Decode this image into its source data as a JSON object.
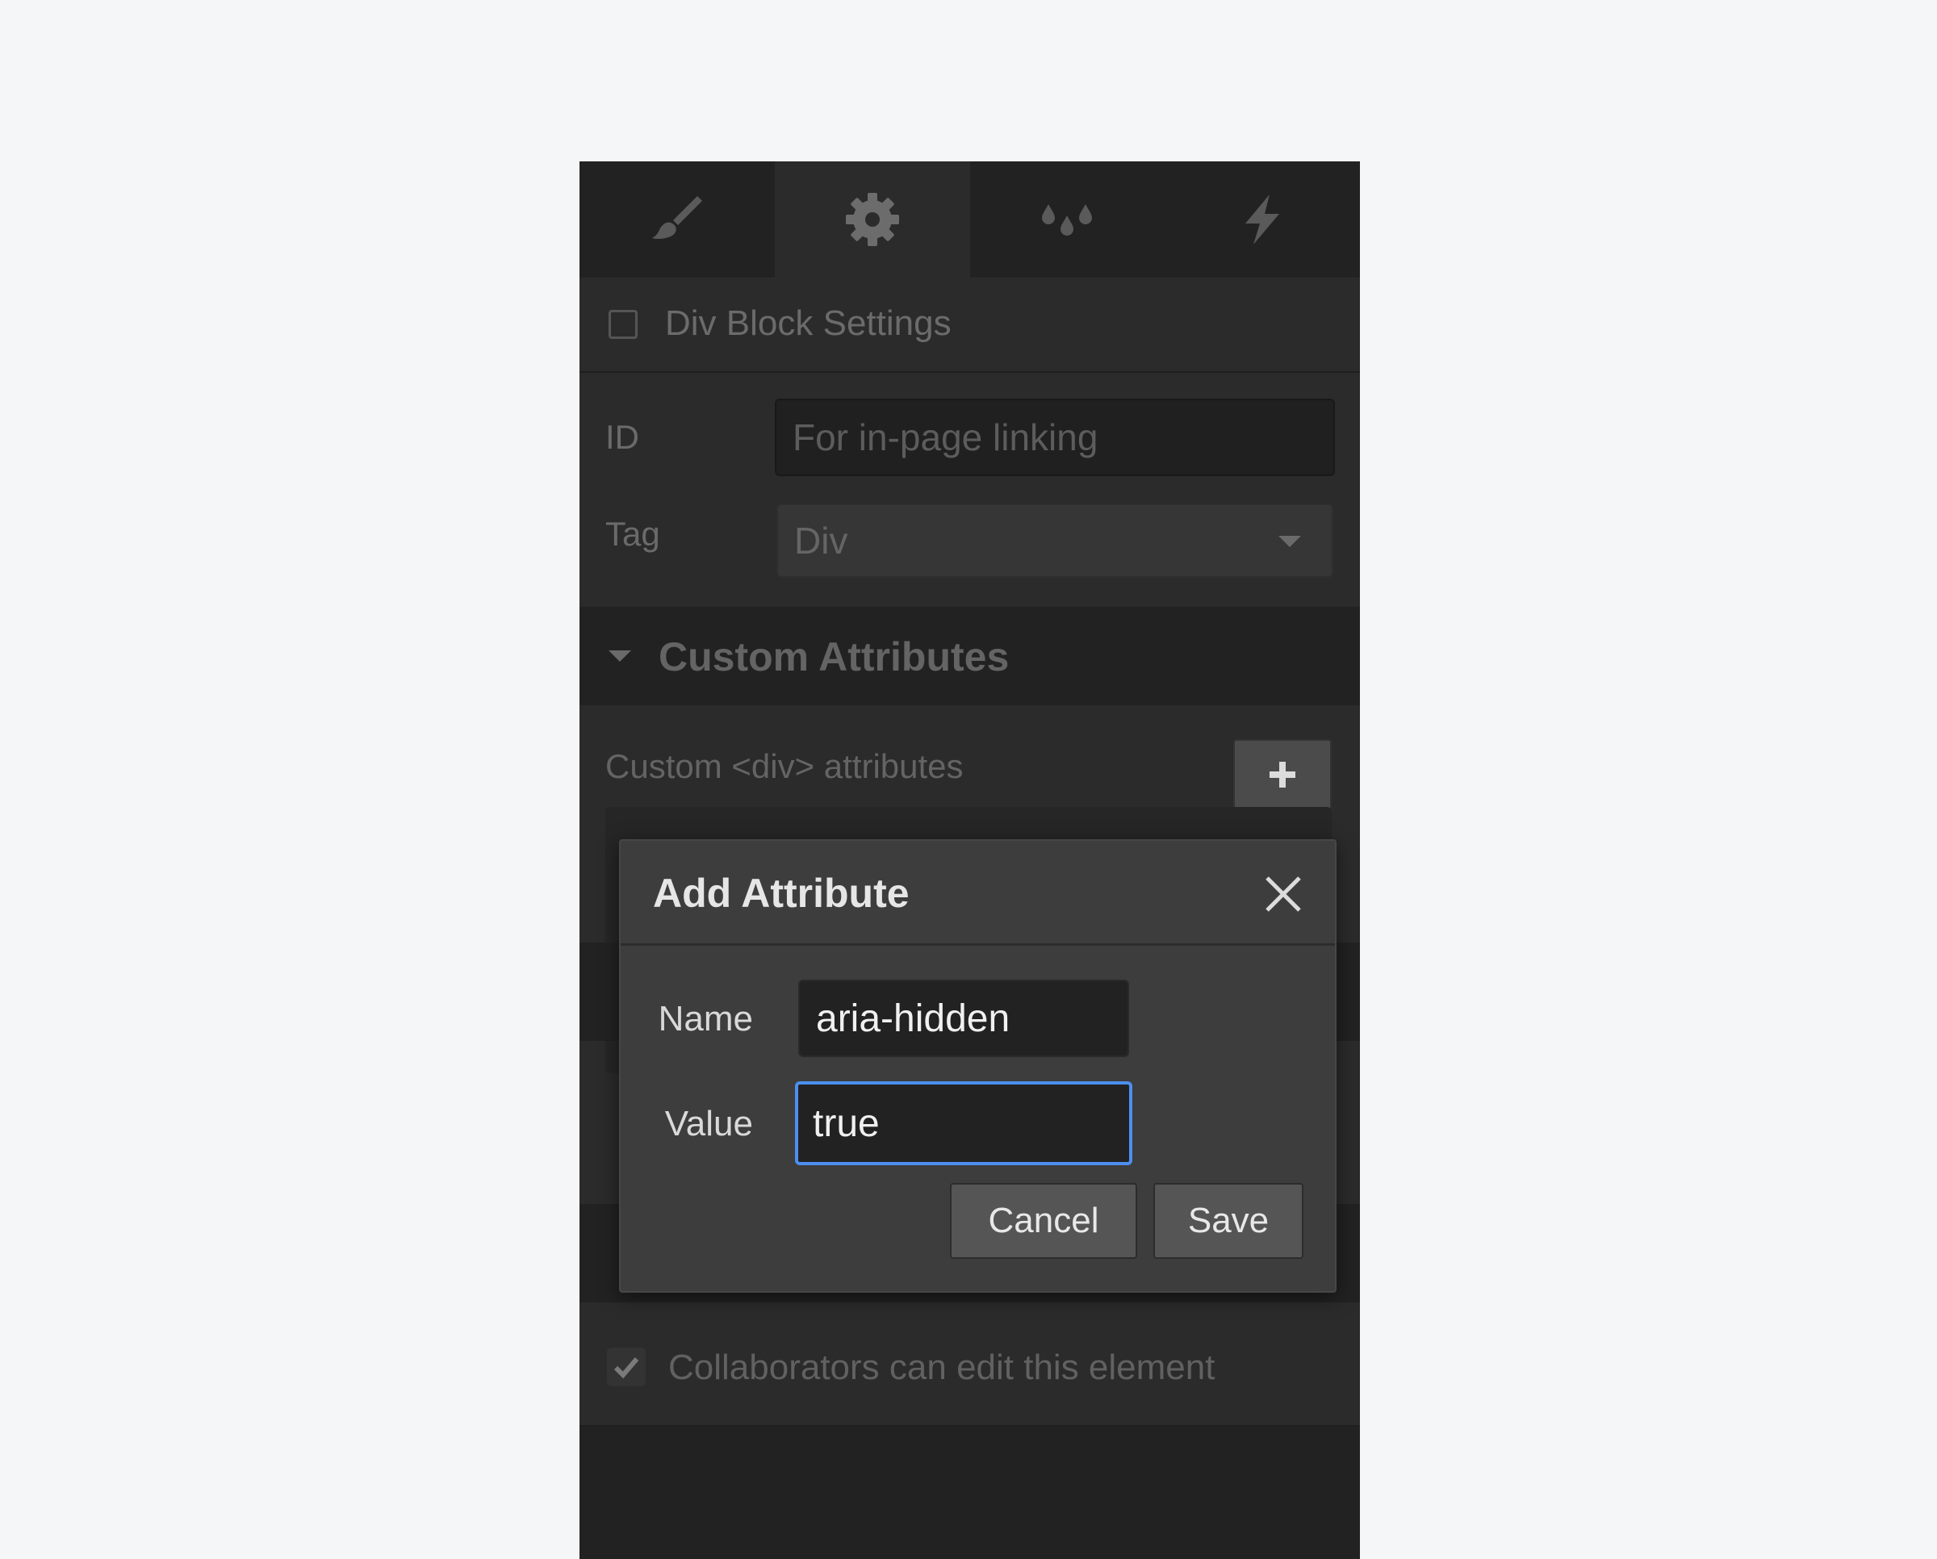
{
  "tabs": [
    {
      "name": "style",
      "icon": "paintbrush-icon"
    },
    {
      "name": "settings",
      "icon": "gear-icon",
      "active": true
    },
    {
      "name": "style-manager",
      "icon": "drops-icon"
    },
    {
      "name": "interactions",
      "icon": "lightning-icon"
    }
  ],
  "block_settings": {
    "title": "Div Block Settings"
  },
  "id_field": {
    "label": "ID",
    "placeholder": "For in-page linking"
  },
  "tag_field": {
    "label": "Tag",
    "value": "Div"
  },
  "custom_attributes": {
    "title": "Custom Attributes",
    "list_label": "Custom <div> attributes",
    "add_label": "+"
  },
  "collaborators": {
    "label": "Collaborators can edit this element",
    "checked": true
  },
  "modal": {
    "title": "Add Attribute",
    "name_label": "Name",
    "name_value": "aria-hidden",
    "value_label": "Value",
    "value_value": "true",
    "cancel_label": "Cancel",
    "save_label": "Save"
  },
  "colors": {
    "focus_ring": "#4c8ff0",
    "panel_bg": "#2b2b2b",
    "page_bg": "#f5f6f8"
  }
}
